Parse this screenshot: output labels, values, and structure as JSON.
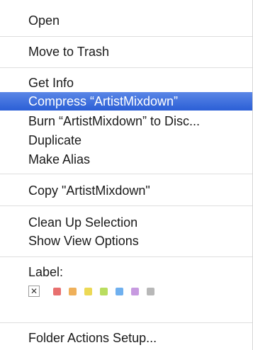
{
  "menu": {
    "items": [
      {
        "label": "Open"
      },
      {
        "label": "Move to Trash"
      },
      {
        "label": "Get Info"
      },
      {
        "label": "Compress “ArtistMixdown”",
        "selected": true
      },
      {
        "label": "Burn “ArtistMixdown” to Disc..."
      },
      {
        "label": "Duplicate"
      },
      {
        "label": "Make Alias"
      },
      {
        "label": "Copy \"ArtistMixdown\""
      },
      {
        "label": "Clean Up Selection"
      },
      {
        "label": "Show View Options"
      },
      {
        "label": "Folder Actions Setup..."
      }
    ],
    "label_section": {
      "title": "Label:",
      "none_symbol": "✕",
      "colors": [
        {
          "name": "red",
          "hex": "#e8706f"
        },
        {
          "name": "orange",
          "hex": "#efb05a"
        },
        {
          "name": "yellow",
          "hex": "#ecd955"
        },
        {
          "name": "green",
          "hex": "#b9dd5f"
        },
        {
          "name": "blue",
          "hex": "#6fb0ef"
        },
        {
          "name": "purple",
          "hex": "#c79ae0"
        },
        {
          "name": "gray",
          "hex": "#b8b8b8"
        }
      ]
    },
    "selection_color": "#3a6fdd"
  }
}
